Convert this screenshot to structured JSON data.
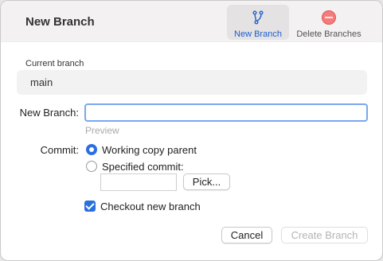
{
  "window": {
    "title": "New Branch"
  },
  "toolbar": {
    "new_branch_label": "New Branch",
    "delete_branches_label": "Delete Branches",
    "accent": "#1a5fd0",
    "delete_color": "#ee5b5b"
  },
  "current": {
    "label": "Current branch",
    "value": "main"
  },
  "form": {
    "new_branch_label": "New Branch:",
    "new_branch_value": "",
    "preview_label": "Preview",
    "commit_label": "Commit:",
    "option_working": "Working copy parent",
    "option_specified": "Specified commit:",
    "selected_option": "working",
    "commit_value": "",
    "pick_label": "Pick...",
    "checkout_label": "Checkout new branch",
    "checkout_checked": true
  },
  "footer": {
    "cancel_label": "Cancel",
    "create_label": "Create Branch",
    "create_enabled": false
  }
}
